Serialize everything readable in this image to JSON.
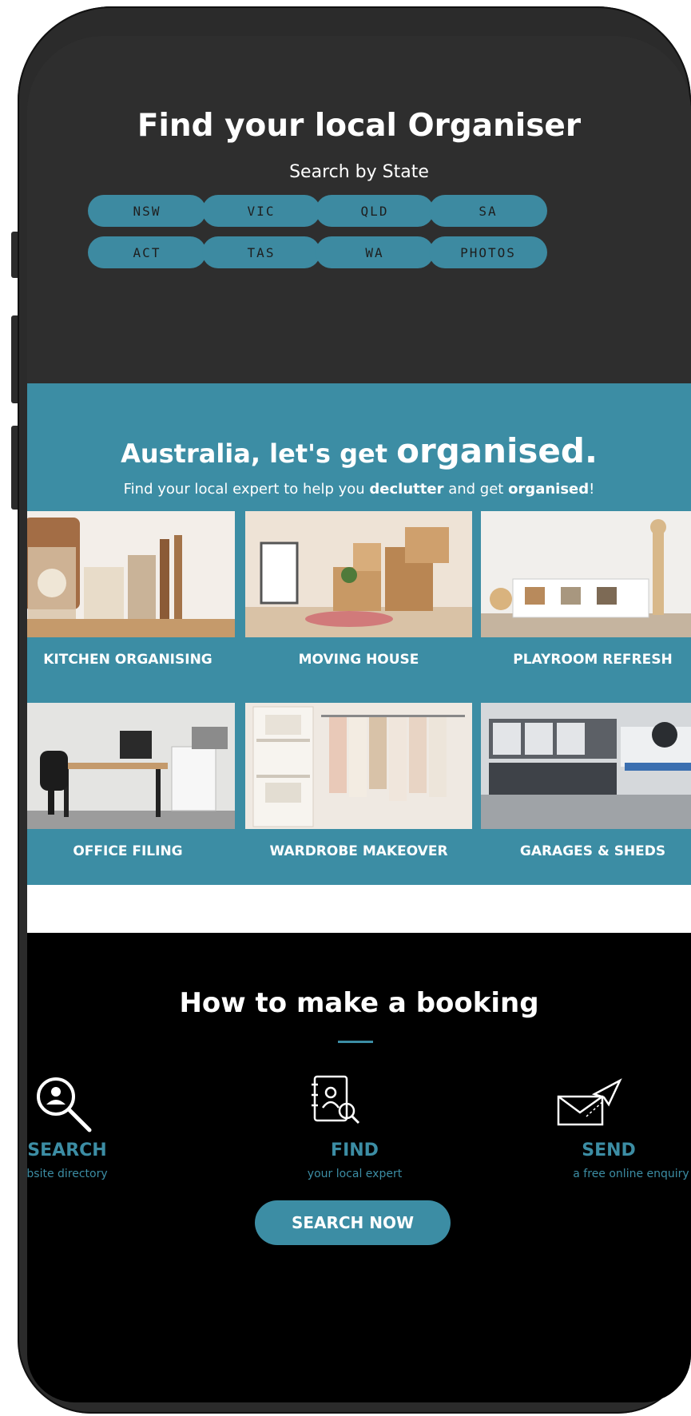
{
  "header": {
    "title": "Find your local Organiser",
    "subtitle": "Search by State",
    "states": [
      "NSW",
      "VIC",
      "QLD",
      "SA",
      "ACT",
      "TAS",
      "WA",
      "PHOTOS"
    ]
  },
  "promo": {
    "heading_pre": "Australia, let's get ",
    "heading_bold": "organised.",
    "sub_pre": "Find your local expert to help you ",
    "sub_bold1": "declutter",
    "sub_mid": " and get ",
    "sub_bold2": "organised",
    "sub_end": "!",
    "categories": [
      {
        "label": "KITCHEN ORGANISING",
        "icon": "kitchen-photo"
      },
      {
        "label": "MOVING HOUSE",
        "icon": "moving-photo"
      },
      {
        "label": "PLAYROOM REFRESH",
        "icon": "playroom-photo"
      },
      {
        "label": "OFFICE FILING",
        "icon": "office-photo"
      },
      {
        "label": "WARDROBE MAKEOVER",
        "icon": "wardrobe-photo"
      },
      {
        "label": "GARAGES & SHEDS",
        "icon": "garage-photo"
      }
    ]
  },
  "booking": {
    "title": "How to make a booking",
    "steps": [
      {
        "title": "SEARCH",
        "sub": "website directory",
        "icon": "search-person-icon"
      },
      {
        "title": "FIND",
        "sub": "your local expert",
        "icon": "address-book-icon"
      },
      {
        "title": "SEND",
        "sub": "a free online enquiry",
        "icon": "envelope-send-icon"
      }
    ],
    "cta": "SEARCH NOW"
  },
  "colors": {
    "accent": "#3c8da4",
    "dark": "#2e2e2e",
    "black": "#000000"
  }
}
